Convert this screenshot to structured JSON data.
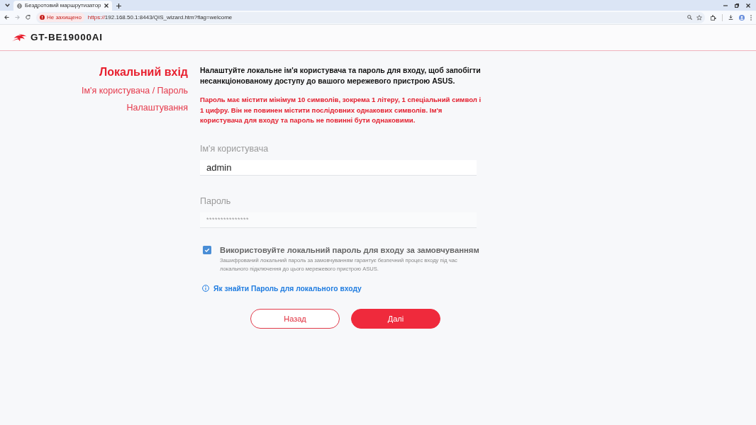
{
  "browser": {
    "tab": {
      "title": "Бездротовий маршрутизатор"
    },
    "forward_enabled": false,
    "security_chip": "Не захищено",
    "url": {
      "scheme": "https://",
      "rest": "192.168.50.1:8443/QIS_wizard.htm?flag=welcome"
    }
  },
  "header": {
    "model": "GT-BE19000AI"
  },
  "steps": [
    {
      "label": "Локальний вхід",
      "selected": true
    },
    {
      "label": "Ім'я користувача / Пароль",
      "selected": false
    },
    {
      "label": "Налаштування",
      "selected": false
    }
  ],
  "intro": "Налаштуйте локальне ім'я користувача та пароль для входу, щоб запобігти несанкціонованому доступу до вашого мережевого пристрою ASUS.",
  "requirements": "Пароль має містити мінімум 10 символів, зокрема 1 літеру, 1 спеціальний символ і 1 цифру. Він не повинен містити послідовних однакових символів. Ім'я користувача для входу та пароль не повинні бути однаковими.",
  "fields": [
    {
      "label": "Ім'я користувача",
      "value": "admin",
      "kind": "text"
    },
    {
      "label": "Пароль",
      "value": "***************",
      "kind": "password"
    }
  ],
  "default_password": {
    "checked": true,
    "label": "Використовуйте локальний пароль для входу за замовчуванням",
    "description": "Зашифрований локальний пароль за замовчуванням гарантує безпечний процес входу під час локального підключення до цього мережевого пристрою ASUS."
  },
  "help_link": "Як знайти Пароль для локального входу",
  "buttons": [
    {
      "label": "Назад",
      "kind": "outline"
    },
    {
      "label": "Далі",
      "kind": "primary"
    }
  ]
}
